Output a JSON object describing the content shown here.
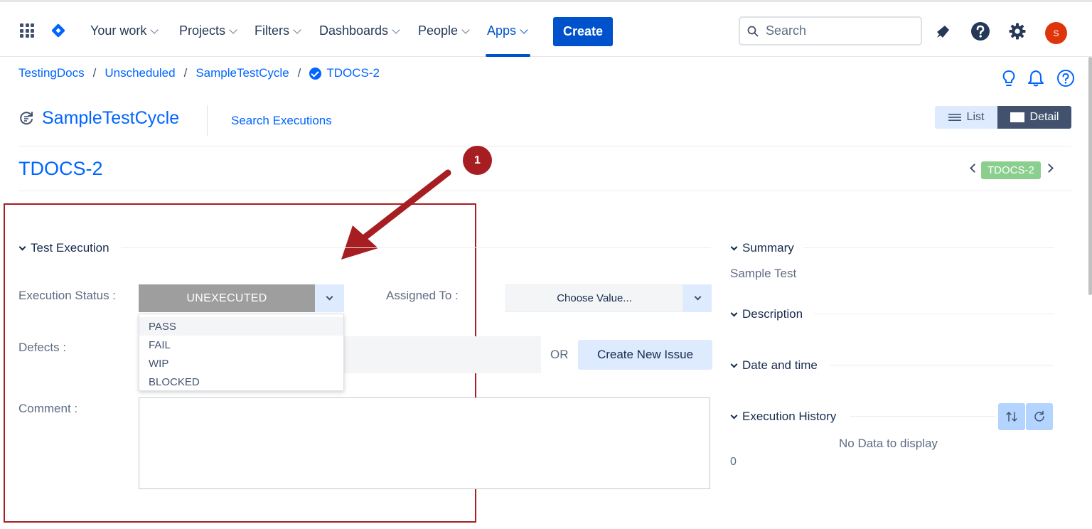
{
  "topnav": {
    "items": [
      {
        "label": "Your work"
      },
      {
        "label": "Projects"
      },
      {
        "label": "Filters"
      },
      {
        "label": "Dashboards"
      },
      {
        "label": "People"
      },
      {
        "label": "Apps"
      }
    ],
    "create_label": "Create",
    "search_placeholder": "Search",
    "avatar_initial": "S"
  },
  "breadcrumb": {
    "items": [
      "TestingDocs",
      "Unscheduled",
      "SampleTestCycle",
      "TDOCS-2"
    ],
    "separator": "/"
  },
  "cycle": {
    "title": "SampleTestCycle",
    "search_executions": "Search Executions",
    "view_list": "List",
    "view_detail": "Detail"
  },
  "issue": {
    "key": "TDOCS-2",
    "badge": "TDOCS-2"
  },
  "annotation": {
    "badge_number": "1"
  },
  "execution": {
    "section_title": "Test Execution",
    "status_label": "Execution Status :",
    "status_value": "UNEXECUTED",
    "status_options": [
      "PASS",
      "FAIL",
      "WIP",
      "BLOCKED"
    ],
    "assigned_label": "Assigned To :",
    "assigned_value": "Choose Value...",
    "defects_label": "Defects :",
    "or_text": "OR",
    "create_issue_label": "Create New Issue",
    "comment_label": "Comment :"
  },
  "sidebar": {
    "summary_title": "Summary",
    "summary_text": "Sample Test",
    "description_title": "Description",
    "datetime_title": "Date and time",
    "history_title": "Execution History",
    "no_data": "No Data to display",
    "count": "0"
  },
  "colors": {
    "accent": "#0052cc",
    "link": "#0065ff",
    "annotation": "#a61e22",
    "badge_green": "#8bcf8f",
    "status_gray": "#9e9e9e"
  }
}
